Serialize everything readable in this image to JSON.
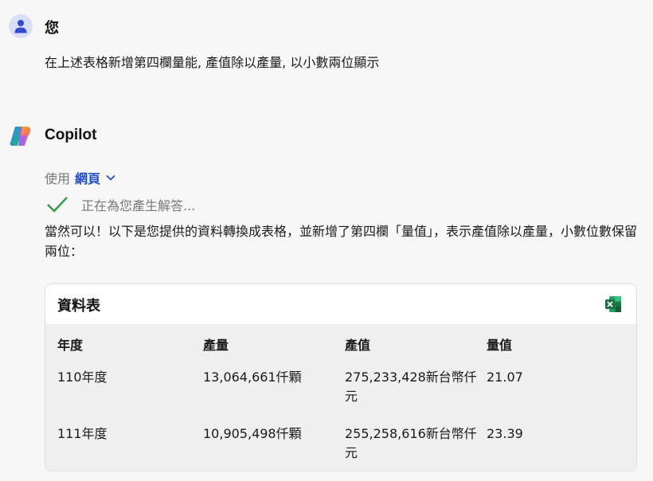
{
  "user": {
    "name": "您",
    "message": "在上述表格新增第四欄量能, 產值除以產量, 以小數兩位顯示",
    "avatar_icon": "person-icon"
  },
  "copilot": {
    "name": "Copilot",
    "logo_icon": "copilot-logo-icon",
    "using_prefix": "使用",
    "using_source": "網頁",
    "status_text": "正在為您產生解答...",
    "answer": "當然可以！以下是您提供的資料轉換成表格，並新增了第四欄「量值」，表示產值除以產量，小數位數保留兩位："
  },
  "table": {
    "title": "資料表",
    "export_icon": "excel-icon",
    "columns": [
      "年度",
      "產量",
      "產值",
      "量值"
    ],
    "rows": [
      [
        "110年度",
        "13,064,661仟顆",
        "275,233,428新台幣仟元",
        "21.07"
      ],
      [
        "111年度",
        "10,905,498仟顆",
        "255,258,616新台幣仟元",
        "23.39"
      ]
    ]
  },
  "colors": {
    "link": "#1f4fd1",
    "check": "#2e9e44",
    "excel": "#1d7044"
  }
}
